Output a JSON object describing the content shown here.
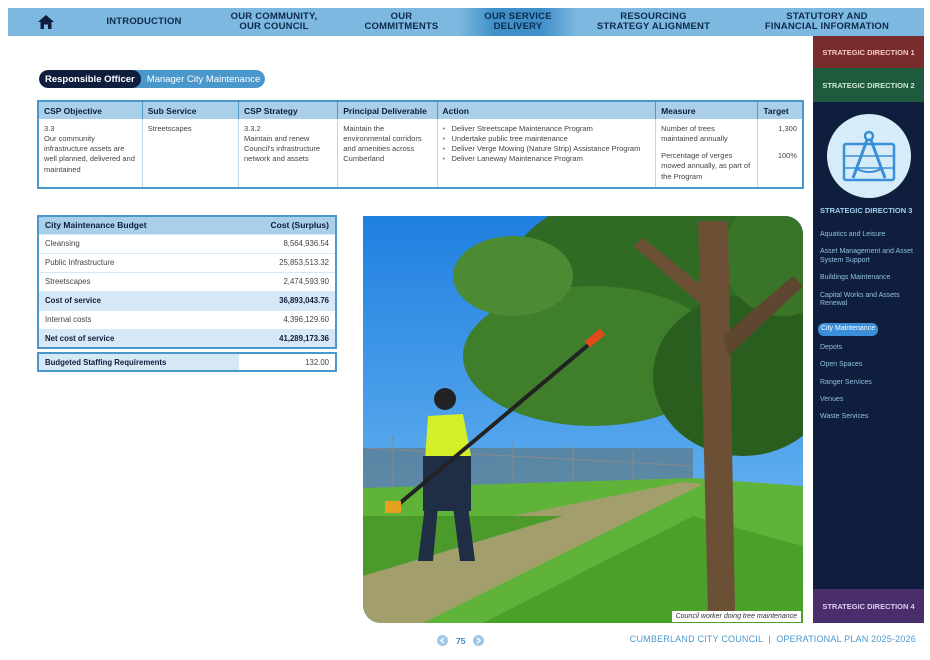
{
  "nav": {
    "items": [
      {
        "label": "INTRODUCTION",
        "active": false
      },
      {
        "label": "OUR COMMUNITY,\nOUR COUNCIL",
        "active": false
      },
      {
        "label": "OUR\nCOMMITMENTS",
        "active": false
      },
      {
        "label": "OUR SERVICE\nDELIVERY",
        "active": true
      },
      {
        "label": "RESOURCING\nSTRATEGY ALIGNMENT",
        "active": false
      },
      {
        "label": "STATUTORY AND\nFINANCIAL INFORMATION",
        "active": false
      }
    ],
    "home_icon": "home-icon"
  },
  "officer": {
    "label": "Responsible Officer",
    "value": "Manager City Maintenance"
  },
  "csp_table": {
    "headers": [
      "CSP Objective",
      "Sub Service",
      "CSP Strategy",
      "Principal Deliverable",
      "Action",
      "Measure",
      "Target"
    ],
    "objective": "3.3\nOur community infrastructure assets are well planned, delivered and maintained",
    "sub_service": "Streetscapes",
    "strategy": "3.3.2\nMaintain and renew Council's infrastructure network and assets",
    "deliverable": "Maintain the environmental corridors and amenities across Cumberland",
    "actions": [
      "Deliver Streetscape Maintenance Program",
      "Undertake public tree maintenance",
      "Deliver Verge Mowing (Nature Strip) Assistance Program",
      "Deliver Laneway Maintenance Program"
    ],
    "measures": [
      "Number of trees maintained annually",
      "Percentage of verges mowed annually, as part of the Program"
    ],
    "targets": [
      "1,300",
      "100%"
    ]
  },
  "budget": {
    "header_label": "City Maintenance Budget",
    "header_value": "Cost (Surplus)",
    "rows": [
      {
        "label": "Cleansing",
        "value": "8,564,936.54",
        "total": false
      },
      {
        "label": "Public Infrastructure",
        "value": "25,853,513.32",
        "total": false
      },
      {
        "label": "Streetscapes",
        "value": "2,474,593.90",
        "total": false
      },
      {
        "label": "Cost of service",
        "value": "36,893,043.76",
        "total": true
      },
      {
        "label": "Internal costs",
        "value": "4,396,129.60",
        "total": false
      },
      {
        "label": "Net cost of service",
        "value": "41,289,173.36",
        "total": true
      }
    ]
  },
  "staffing": {
    "label": "Budgeted Staffing Requirements",
    "value": "132.00"
  },
  "photo": {
    "caption": "Council worker doing tree maintenance"
  },
  "sidebar": {
    "dir1": "STRATEGIC DIRECTION 1",
    "dir2": "STRATEGIC DIRECTION 2",
    "dir3": "STRATEGIC DIRECTION 3",
    "dir4": "STRATEGIC DIRECTION 4",
    "items": [
      {
        "label": "Aquatics and Leisure",
        "active": false
      },
      {
        "label": "Asset Management and Asset System Support",
        "active": false
      },
      {
        "label": "Buildings Maintenance",
        "active": false
      },
      {
        "label": "Capital Works and Assets Renewal",
        "active": false
      },
      {
        "label": "City Maintenance",
        "active": true
      },
      {
        "label": "Depots",
        "active": false
      },
      {
        "label": "Open Spaces",
        "active": false
      },
      {
        "label": "Ranger Services",
        "active": false
      },
      {
        "label": "Venues",
        "active": false
      },
      {
        "label": "Waste Services",
        "active": false
      }
    ]
  },
  "footer": {
    "page_number": "75",
    "text": "CUMBERLAND CITY COUNCIL  |  OPERATIONAL PLAN 2025-2026"
  }
}
